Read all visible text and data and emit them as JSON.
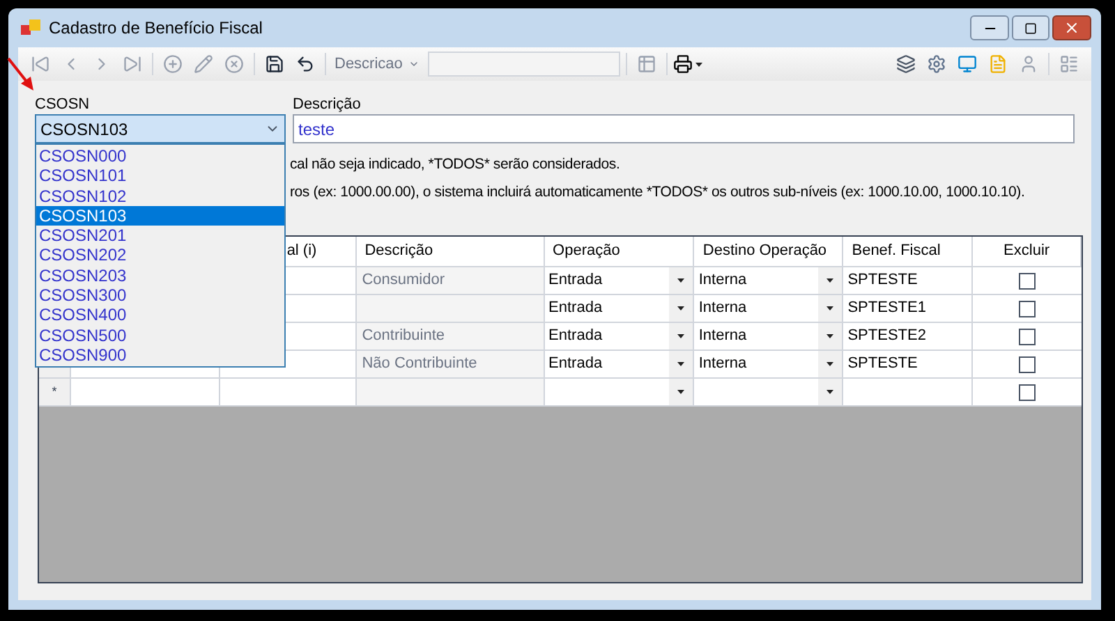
{
  "window": {
    "title": "Cadastro de Benefício Fiscal"
  },
  "toolbar": {
    "search_label": "Descricao"
  },
  "form": {
    "csosn_label": "CSOSN",
    "csosn_value": "CSOSN103",
    "descricao_label": "Descrição",
    "descricao_value": "teste",
    "csosn_options": [
      {
        "label": "CSOSN000",
        "selected": false
      },
      {
        "label": "CSOSN101",
        "selected": false
      },
      {
        "label": "CSOSN102",
        "selected": false
      },
      {
        "label": "CSOSN103",
        "selected": true
      },
      {
        "label": "CSOSN201",
        "selected": false
      },
      {
        "label": "CSOSN202",
        "selected": false
      },
      {
        "label": "CSOSN203",
        "selected": false
      },
      {
        "label": "CSOSN300",
        "selected": false
      },
      {
        "label": "CSOSN400",
        "selected": false
      },
      {
        "label": "CSOSN500",
        "selected": false
      },
      {
        "label": "CSOSN900",
        "selected": false
      }
    ]
  },
  "notes": [
    "cal não seja indicado, *TODOS* serão considerados.",
    "ros (ex: 1000.00.00), o sistema incluirá automaticamente *TODOS* os outros sub-níveis (ex: 1000.10.00, 1000.10.10)."
  ],
  "table": {
    "columns": [
      "al (i)",
      "Descrição",
      "Operação",
      "Destino Operação",
      "Benef. Fiscal",
      "Excluir"
    ],
    "rows": [
      {
        "descricao": "Consumidor",
        "operacao": "Entrada",
        "destino": "Interna",
        "beneficio": "SPTESTE",
        "excluir": false
      },
      {
        "operacao": "Entrada",
        "destino": "Interna",
        "beneficio": "SPTESTE1",
        "excluir": false
      },
      {
        "descricao": "Contribuinte",
        "operacao": "Entrada",
        "destino": "Interna",
        "beneficio": "SPTESTE2",
        "excluir": false
      },
      {
        "descricao": "Não Contribuinte",
        "operacao": "Entrada",
        "destino": "Interna",
        "beneficio": "SPTESTE",
        "excluir": false
      }
    ],
    "new_row": {
      "marker": "*",
      "excluir": false
    }
  }
}
